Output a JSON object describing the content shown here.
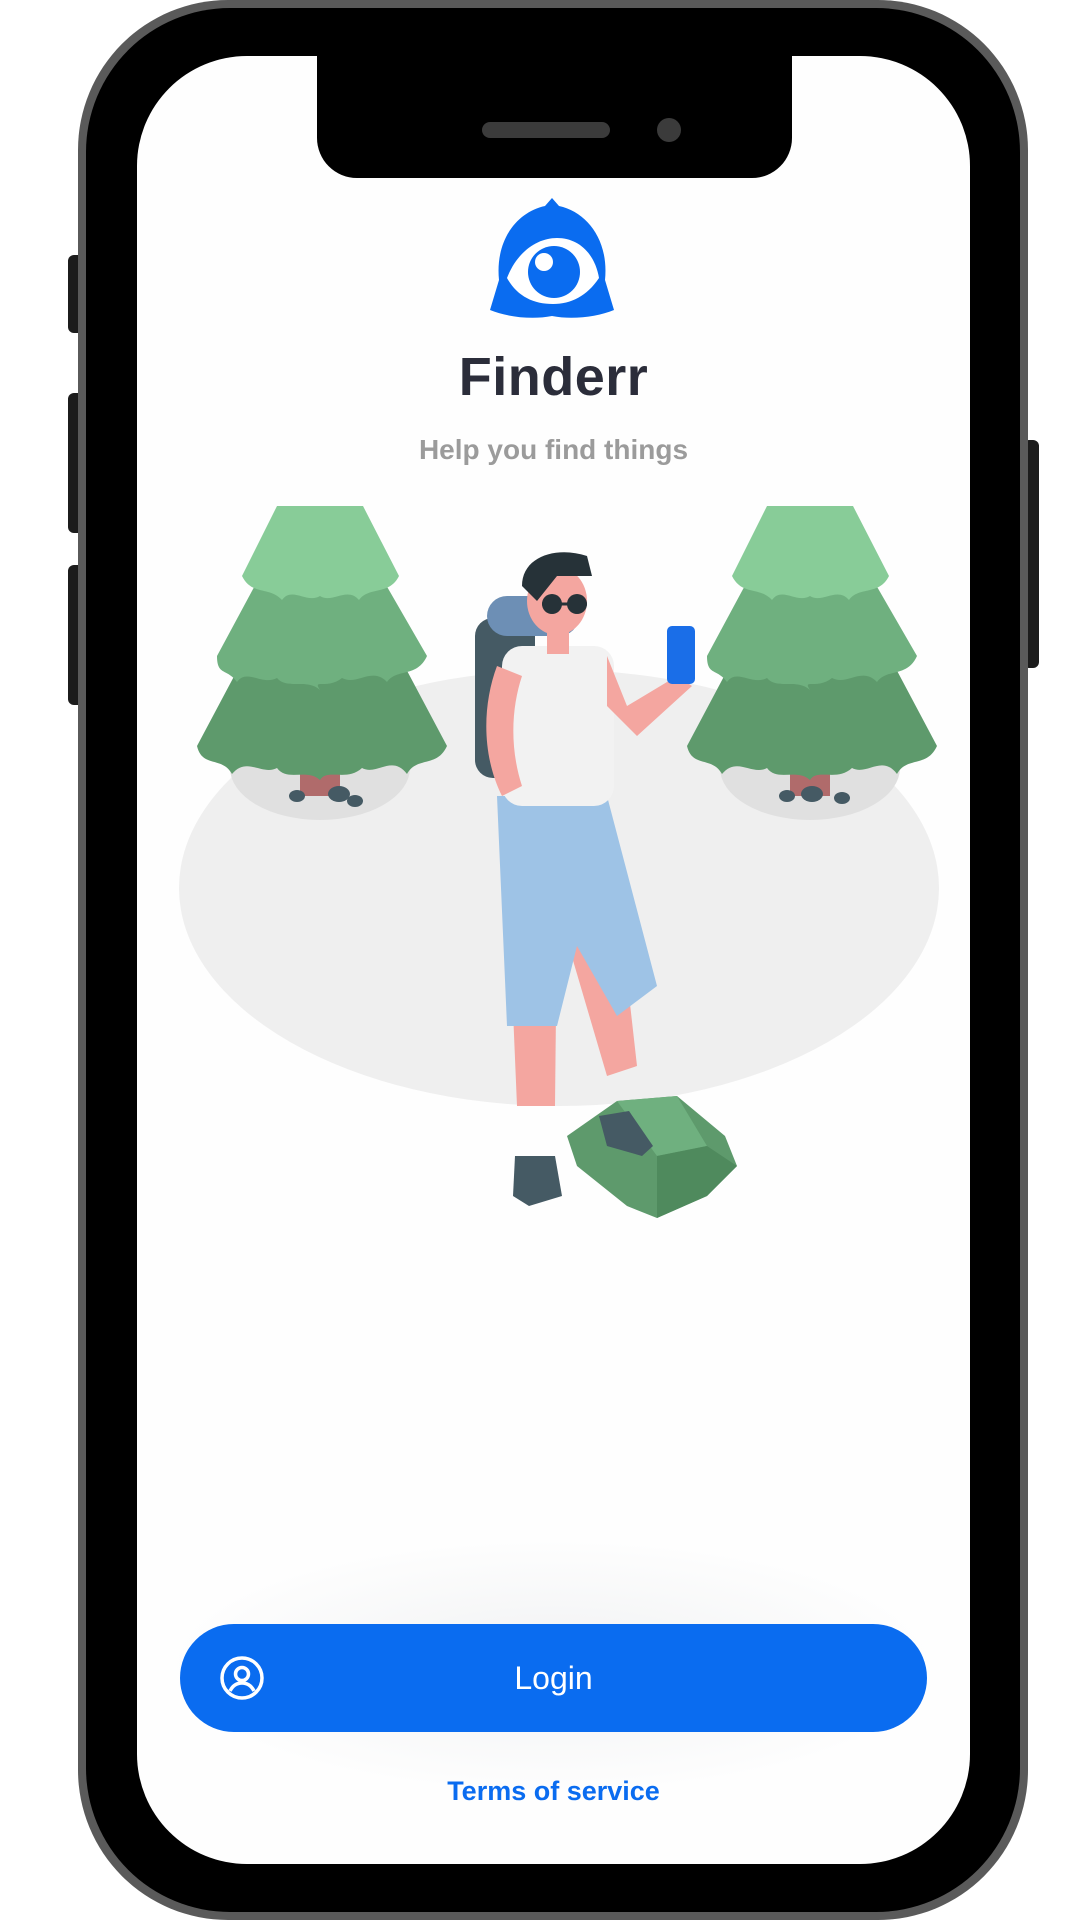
{
  "app": {
    "title": "Finderr",
    "subtitle": "Help you find things"
  },
  "icons": {
    "logo": "eye-logo-icon",
    "login": "user-circle-icon"
  },
  "actions": {
    "login_label": "Login",
    "terms_label": "Terms of service"
  },
  "colors": {
    "brand_blue": "#0a6cf0",
    "title_text": "#2b2d3a",
    "subtitle_text": "#9b9b9b",
    "device_frame": "#000000",
    "tree_light": "#88cc98",
    "tree_mid": "#6fb07f",
    "tree_dark": "#5e9a6c",
    "ground": "#efefef"
  }
}
